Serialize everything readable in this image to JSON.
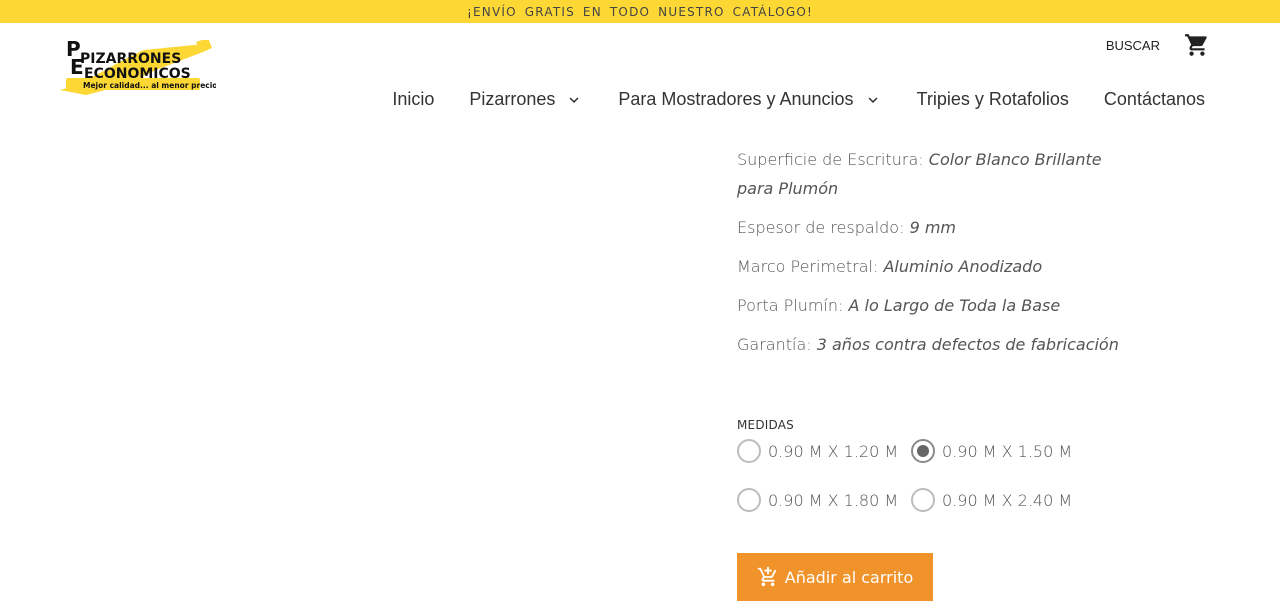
{
  "promo": {
    "text": "¡ENVÍO GRATIS EN TODO NUESTRO CATÁLOGO!"
  },
  "brand": {
    "line1": "PIZARRONES",
    "line2": "ECONOMICOS",
    "tagline": "Mejor calidad... al menor precio",
    "accent_color": "#fdd835"
  },
  "header": {
    "search_label": "BUSCAR",
    "cart_icon": "shopping-cart-icon"
  },
  "nav": {
    "items": [
      {
        "label": "Inicio",
        "has_dropdown": false
      },
      {
        "label": "Pizarrones",
        "has_dropdown": true
      },
      {
        "label": "Para Mostradores y Anuncios",
        "has_dropdown": true
      },
      {
        "label": "Tripies y Rotafolios",
        "has_dropdown": false
      },
      {
        "label": "Contáctanos",
        "has_dropdown": false
      }
    ]
  },
  "specs": [
    {
      "key": "Superficie de Escritura:",
      "value": "Color Blanco Brillante para Plumón"
    },
    {
      "key": "Espesor de respaldo:",
      "value": "9 mm"
    },
    {
      "key": "Marco Perimetral:",
      "value": "Aluminio Anodizado"
    },
    {
      "key": "Porta Plumín:",
      "value": "A lo Largo de Toda la Base"
    },
    {
      "key": "Garantía:",
      "value": "3 años contra defectos de fabricación"
    }
  ],
  "sizes": {
    "label": "MEDIDAS",
    "options": [
      {
        "label": "0.90 M X 1.20 M",
        "selected": false
      },
      {
        "label": "0.90 M X 1.50 M",
        "selected": true
      },
      {
        "label": "0.90 M X 1.80 M",
        "selected": false
      },
      {
        "label": "0.90 M X 2.40 M",
        "selected": false
      }
    ]
  },
  "cart_button": {
    "label": "Añadir al carrito",
    "color": "#f0932b"
  }
}
